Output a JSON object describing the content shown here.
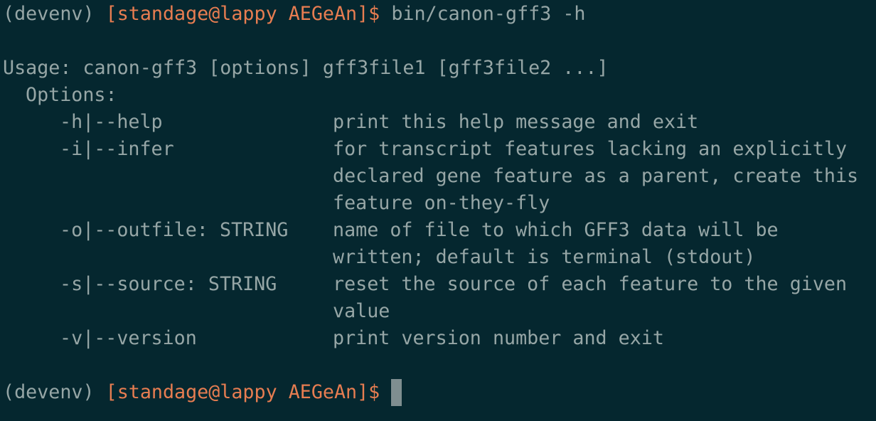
{
  "terminal": {
    "prompt": {
      "env": "(devenv)",
      "user_host": "[standage@lappy AEGeAn]$"
    },
    "command": "bin/canon-gff3 -h",
    "usage": "Usage: canon-gff3 [options] gff3file1 [gff3file2 ...]",
    "options_heading": "Options:",
    "options": [
      {
        "flag": "-h|--help",
        "desc": [
          "print this help message and exit"
        ]
      },
      {
        "flag": "-i|--infer",
        "desc": [
          "for transcript features lacking an explicitly",
          "declared gene feature as a parent, create this",
          "feature on-they-fly"
        ]
      },
      {
        "flag": "-o|--outfile: STRING",
        "desc": [
          "name of file to which GFF3 data will be",
          "written; default is terminal (stdout)"
        ]
      },
      {
        "flag": "-s|--source: STRING",
        "desc": [
          "reset the source of each feature to the given",
          "value"
        ]
      },
      {
        "flag": "-v|--version",
        "desc": [
          "print version number and exit"
        ]
      }
    ],
    "colors": {
      "background": "#05272f",
      "text": "#96a6a6",
      "prompt_user": "#e77d51",
      "cursor": "#7f8e90"
    }
  }
}
